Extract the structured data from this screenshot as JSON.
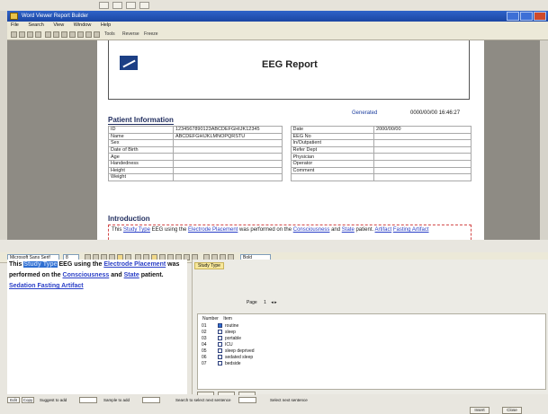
{
  "window": {
    "title": "Word Viewer Report Builder"
  },
  "menu": [
    "File",
    "Search",
    "View",
    "Window",
    "Help"
  ],
  "toolbar": {
    "text_label": "Tools",
    "mode_label": "Reverse",
    "zoom_label": "Freeze"
  },
  "report": {
    "title": "EEG Report",
    "generated_label": "Generated",
    "generated_value": "0000/00/00 16:46:27",
    "patient_info_heading": "Patient Information",
    "introduction_heading": "Introduction"
  },
  "patient_table": [
    [
      "ID",
      "1234567890123ABCDEFGHIJK12345",
      "Date",
      "2000/00/00"
    ],
    [
      "Name",
      "ABCDEFGHIJKLMNOPQRSTU",
      "EEG No",
      ""
    ],
    [
      "Sex",
      "",
      "In/Outpatient",
      ""
    ],
    [
      "Date of Birth",
      "",
      "Refer Dept",
      ""
    ],
    [
      "Age",
      "",
      "Physician",
      ""
    ],
    [
      "Handedness",
      "",
      "Operator",
      ""
    ],
    [
      "Height",
      "",
      "Comment",
      ""
    ],
    [
      "Weight",
      "",
      "",
      ""
    ]
  ],
  "intro": {
    "t1": "This",
    "link1": "Study Type",
    "t2": "EEG using the",
    "link2": "Electrode Placement",
    "t3": "was performed on the",
    "link3": "Consciousness",
    "t4": "and",
    "link4": "State",
    "t5": "patient.",
    "link5": "Artifact",
    "link6": "Fasting Artifact"
  },
  "editor": {
    "font": "Microsoft Sans Serif",
    "size": "8",
    "style": "Bold",
    "t1": "This",
    "hl": "Study Type",
    "t2": "EEG using the",
    "link1": "Electrode Placement",
    "t3": "was performed on the",
    "link2": "Consciousness",
    "t4": "and",
    "link3": "State",
    "t5": "patient.",
    "link4": "Sedation Fasting Artifact"
  },
  "props": {
    "tab": "Study Type",
    "page_label": "Page",
    "page_value": "1",
    "number_header": "Number",
    "item_header": "Item",
    "items": [
      {
        "n": "01",
        "label": "routine",
        "selected": true
      },
      {
        "n": "02",
        "label": "sleep",
        "selected": false
      },
      {
        "n": "03",
        "label": "portable",
        "selected": false
      },
      {
        "n": "04",
        "label": "ICU",
        "selected": false
      },
      {
        "n": "05",
        "label": "sleep deprived",
        "selected": false
      },
      {
        "n": "06",
        "label": "sedated sleep",
        "selected": false
      },
      {
        "n": "07",
        "label": "bedside",
        "selected": false
      }
    ]
  },
  "statusbar": {
    "b1": "Edit",
    "b2": "Copy",
    "l1": "Suggest to add",
    "l2": "Sample to add",
    "l3": "Search to select next sentence",
    "l4": "Select next sentence"
  },
  "buttons": {
    "ok": "Insert Text",
    "cancel": "Close"
  }
}
